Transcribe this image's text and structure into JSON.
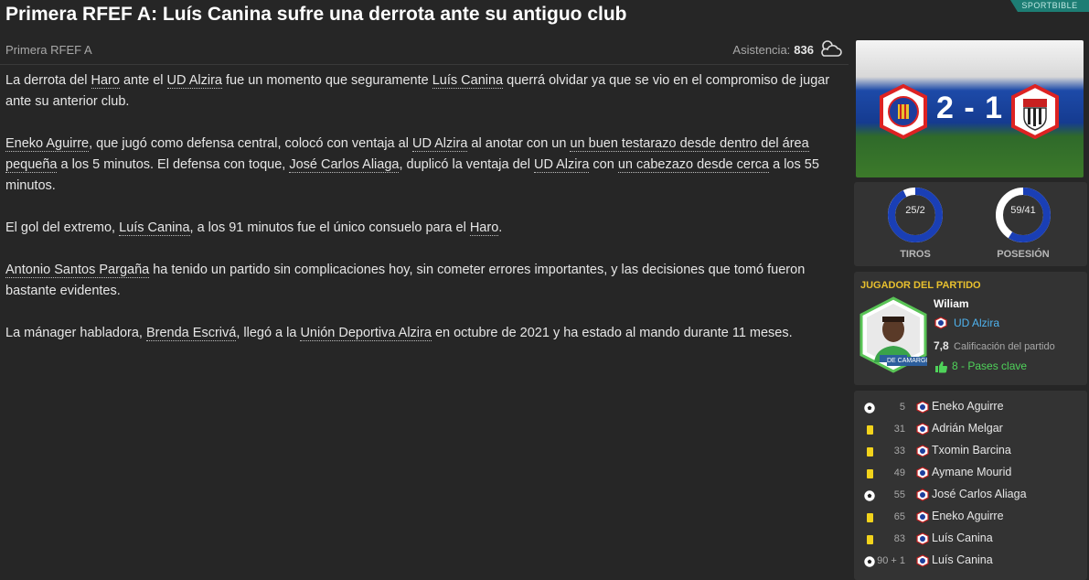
{
  "brand": "SPORTBIBLE",
  "headline": "Primera RFEF A: Luís Canina sufre una derrota ante su antiguo club",
  "meta": {
    "competition": "Primera RFEF A",
    "attendance_label": "Asistencia:",
    "attendance_value": "836"
  },
  "article": {
    "p1": [
      "La derrota del ",
      "Haro",
      " ante el ",
      "UD Alzira",
      " fue un momento que seguramente ",
      "Luís Canina",
      " querrá olvidar ya que se vio en el compromiso de jugar ante su anterior club."
    ],
    "p2": [
      "Eneko Aguirre",
      ", que jugó como defensa central, colocó con ventaja al ",
      "UD Alzira",
      " al anotar con un ",
      "un buen testarazo desde dentro del área pequeña",
      " a los 5 minutos. El defensa con toque, ",
      "José Carlos Aliaga",
      ", duplicó la ventaja del ",
      "UD Alzira",
      " con ",
      "un cabezazo desde cerca",
      " a los 55 minutos."
    ],
    "p3": [
      "El gol del extremo, ",
      "Luís Canina",
      ", a los 91 minutos fue el único consuelo para el ",
      "Haro",
      "."
    ],
    "p4": [
      "Antonio Santos Pargaña",
      " ha tenido un partido sin complicaciones hoy, sin cometer errores importantes, y las decisiones que tomó fueron bastante evidentes."
    ],
    "p5": [
      "La mánager habladora, ",
      "Brenda Escrivá",
      ", llegó a la ",
      "Unión Deportiva Alzira",
      " en octubre de 2021 y ha estado al mando durante 11 meses."
    ]
  },
  "score": {
    "text": "2 - 1",
    "home": 2,
    "away": 1
  },
  "stats": [
    {
      "value": "25/2",
      "label": "TIROS",
      "home_fraction": 0.926,
      "color_home": "#1a3fb5",
      "color_away": "#ffffff"
    },
    {
      "value": "59/41",
      "label": "POSESIÓN",
      "home_fraction": 0.59,
      "color_home": "#1a3fb5",
      "color_away": "#ffffff"
    }
  ],
  "potm": {
    "header": "JUGADOR DEL PARTIDO",
    "name": "Wiliam",
    "club": "UD Alzira",
    "rating": "7,8",
    "rating_label": "Calificación del partido",
    "passes": "8 - Pases clave",
    "card_text": "DE CAMARGO"
  },
  "events": [
    {
      "type": "goal-icon",
      "minute": "5",
      "player": "Eneko Aguirre"
    },
    {
      "type": "yellow-card-icon",
      "minute": "31",
      "player": "Adrián Melgar"
    },
    {
      "type": "yellow-card-icon",
      "minute": "33",
      "player": "Txomin Barcina"
    },
    {
      "type": "yellow-card-icon",
      "minute": "49",
      "player": "Aymane Mourid"
    },
    {
      "type": "goal-icon",
      "minute": "55",
      "player": "José Carlos Aliaga"
    },
    {
      "type": "yellow-card-icon",
      "minute": "65",
      "player": "Eneko Aguirre"
    },
    {
      "type": "yellow-card-icon",
      "minute": "83",
      "player": "Luís Canina"
    },
    {
      "type": "goal-icon",
      "minute": "90 + 1",
      "player": "Luís Canina"
    }
  ],
  "colors": {
    "accent_gold": "#e8c02e",
    "link_blue": "#4fb3ef",
    "positive_green": "#4fd35a",
    "card_yellow": "#f2d31b"
  }
}
